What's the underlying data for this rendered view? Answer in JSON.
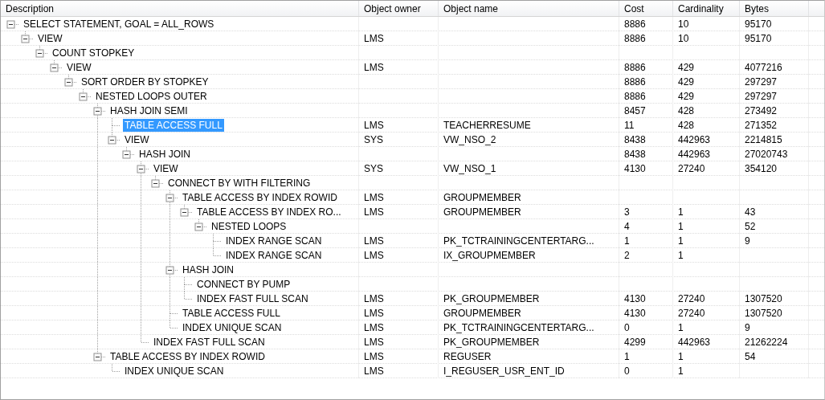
{
  "columns": [
    "Description",
    "Object owner",
    "Object name",
    "Cost",
    "Cardinality",
    "Bytes"
  ],
  "rows": [
    {
      "description": "SELECT STATEMENT, GOAL = ALL_ROWS",
      "cost": "8886",
      "cardinality": "10",
      "bytes": "95170",
      "selected": false,
      "expanded": true,
      "children": [
        {
          "description": "VIEW",
          "owner": "LMS",
          "cost": "8886",
          "cardinality": "10",
          "bytes": "95170",
          "selected": false,
          "expanded": true,
          "children": [
            {
              "description": "COUNT STOPKEY",
              "selected": false,
              "expanded": true,
              "children": [
                {
                  "description": "VIEW",
                  "owner": "LMS",
                  "cost": "8886",
                  "cardinality": "429",
                  "bytes": "4077216",
                  "selected": false,
                  "expanded": true,
                  "children": [
                    {
                      "description": "SORT ORDER BY STOPKEY",
                      "cost": "8886",
                      "cardinality": "429",
                      "bytes": "297297",
                      "selected": false,
                      "expanded": true,
                      "children": [
                        {
                          "description": "NESTED LOOPS OUTER",
                          "cost": "8886",
                          "cardinality": "429",
                          "bytes": "297297",
                          "selected": false,
                          "expanded": true,
                          "children": [
                            {
                              "description": "HASH JOIN SEMI",
                              "cost": "8457",
                              "cardinality": "428",
                              "bytes": "273492",
                              "selected": false,
                              "expanded": true,
                              "children": [
                                {
                                  "description": "TABLE ACCESS FULL",
                                  "owner": "LMS",
                                  "name": "TEACHERRESUME",
                                  "cost": "11",
                                  "cardinality": "428",
                                  "bytes": "271352",
                                  "selected": true
                                },
                                {
                                  "description": "VIEW",
                                  "owner": "SYS",
                                  "name": "VW_NSO_2",
                                  "cost": "8438",
                                  "cardinality": "442963",
                                  "bytes": "2214815",
                                  "selected": false,
                                  "expanded": true,
                                  "children": [
                                    {
                                      "description": "HASH JOIN",
                                      "cost": "8438",
                                      "cardinality": "442963",
                                      "bytes": "27020743",
                                      "selected": false,
                                      "expanded": true,
                                      "children": [
                                        {
                                          "description": "VIEW",
                                          "owner": "SYS",
                                          "name": "VW_NSO_1",
                                          "cost": "4130",
                                          "cardinality": "27240",
                                          "bytes": "354120",
                                          "selected": false,
                                          "expanded": true,
                                          "children": [
                                            {
                                              "description": "CONNECT BY WITH FILTERING",
                                              "selected": false,
                                              "expanded": true,
                                              "children": [
                                                {
                                                  "description": "TABLE ACCESS BY INDEX ROWID",
                                                  "owner": "LMS",
                                                  "name": "GROUPMEMBER",
                                                  "selected": false,
                                                  "expanded": true,
                                                  "children": [
                                                    {
                                                      "description": "TABLE ACCESS BY INDEX RO...",
                                                      "owner": "LMS",
                                                      "name": "GROUPMEMBER",
                                                      "cost": "3",
                                                      "cardinality": "1",
                                                      "bytes": "43",
                                                      "selected": false,
                                                      "expanded": true,
                                                      "children": [
                                                        {
                                                          "description": "NESTED LOOPS",
                                                          "cost": "4",
                                                          "cardinality": "1",
                                                          "bytes": "52",
                                                          "selected": false,
                                                          "expanded": true,
                                                          "children": [
                                                            {
                                                              "description": "INDEX RANGE SCAN",
                                                              "owner": "LMS",
                                                              "name": "PK_TCTRAININGCENTERTARG...",
                                                              "cost": "1",
                                                              "cardinality": "1",
                                                              "bytes": "9",
                                                              "selected": false
                                                            },
                                                            {
                                                              "description": "INDEX RANGE SCAN",
                                                              "owner": "LMS",
                                                              "name": "IX_GROUPMEMBER",
                                                              "cost": "2",
                                                              "cardinality": "1",
                                                              "selected": false
                                                            }
                                                          ]
                                                        }
                                                      ]
                                                    }
                                                  ]
                                                },
                                                {
                                                  "description": "HASH JOIN",
                                                  "selected": false,
                                                  "expanded": true,
                                                  "children": [
                                                    {
                                                      "description": "CONNECT BY PUMP",
                                                      "selected": false
                                                    },
                                                    {
                                                      "description": "INDEX FAST FULL SCAN",
                                                      "owner": "LMS",
                                                      "name": "PK_GROUPMEMBER",
                                                      "cost": "4130",
                                                      "cardinality": "27240",
                                                      "bytes": "1307520",
                                                      "selected": false
                                                    }
                                                  ]
                                                },
                                                {
                                                  "description": "TABLE ACCESS FULL",
                                                  "owner": "LMS",
                                                  "name": "GROUPMEMBER",
                                                  "cost": "4130",
                                                  "cardinality": "27240",
                                                  "bytes": "1307520",
                                                  "selected": false
                                                },
                                                {
                                                  "description": "INDEX UNIQUE SCAN",
                                                  "owner": "LMS",
                                                  "name": "PK_TCTRAININGCENTERTARG...",
                                                  "cost": "0",
                                                  "cardinality": "1",
                                                  "bytes": "9",
                                                  "selected": false
                                                }
                                              ]
                                            }
                                          ]
                                        },
                                        {
                                          "description": "INDEX FAST FULL SCAN",
                                          "owner": "LMS",
                                          "name": "PK_GROUPMEMBER",
                                          "cost": "4299",
                                          "cardinality": "442963",
                                          "bytes": "21262224",
                                          "selected": false
                                        }
                                      ]
                                    }
                                  ]
                                }
                              ]
                            },
                            {
                              "description": "TABLE ACCESS BY INDEX ROWID",
                              "owner": "LMS",
                              "name": "REGUSER",
                              "cost": "1",
                              "cardinality": "1",
                              "bytes": "54",
                              "selected": false,
                              "expanded": true,
                              "children": [
                                {
                                  "description": "INDEX UNIQUE SCAN",
                                  "owner": "LMS",
                                  "name": "I_REGUSER_USR_ENT_ID",
                                  "cost": "0",
                                  "cardinality": "1",
                                  "selected": false
                                }
                              ]
                            }
                          ]
                        }
                      ]
                    }
                  ]
                }
              ]
            }
          ]
        }
      ]
    }
  ]
}
